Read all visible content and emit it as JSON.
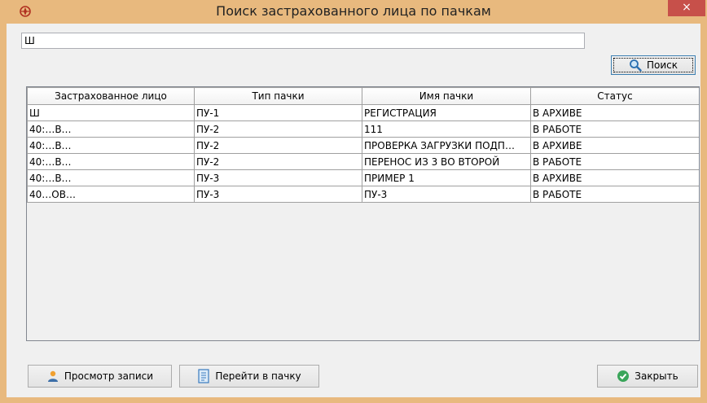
{
  "window": {
    "title": "Поиск застрахованного лица по пачкам",
    "close_glyph": "×",
    "app_icon": "app-emblem-icon",
    "accent": "#e8b97e",
    "close_color": "#c7504a"
  },
  "search": {
    "value": "Ш",
    "button_label": "Поиск",
    "button_icon": "magnifier-icon"
  },
  "table": {
    "columns": [
      "Застрахованное лицо",
      "Тип пачки",
      "Имя пачки",
      "Статус"
    ],
    "rows": [
      {
        "person": "Ш",
        "type": "ПУ-1",
        "name": "РЕГИСТРАЦИЯ",
        "status": "В АРХИВЕ"
      },
      {
        "person": "40:…В…",
        "type": "ПУ-2",
        "name": "111",
        "status": "В РАБОТЕ"
      },
      {
        "person": "40:…В…",
        "type": "ПУ-2",
        "name": "ПРОВЕРКА ЗАГРУЗКИ ПОДП…",
        "status": "В АРХИВЕ"
      },
      {
        "person": "40:…В…",
        "type": "ПУ-2",
        "name": "ПЕРЕНОС ИЗ 3 ВО ВТОРОЙ",
        "status": "В РАБОТЕ"
      },
      {
        "person": "40:…В…",
        "type": "ПУ-3",
        "name": "ПРИМЕР 1",
        "status": "В АРХИВЕ"
      },
      {
        "person": "40…ОВ…",
        "type": "ПУ-3",
        "name": "ПУ-3",
        "status": "В РАБОТЕ"
      }
    ]
  },
  "footer": {
    "view_label": "Просмотр записи",
    "view_icon": "user-icon",
    "goto_label": "Перейти в пачку",
    "goto_icon": "document-icon",
    "close_label": "Закрыть",
    "close_icon": "checkmark-icon"
  }
}
